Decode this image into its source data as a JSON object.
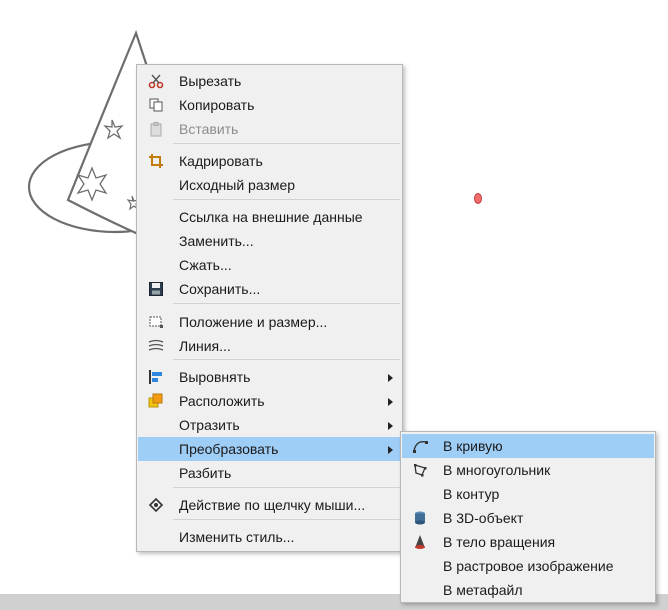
{
  "context_menu": {
    "items": [
      {
        "id": "cut",
        "label": "Вырезать",
        "icon": "scissors-icon",
        "enabled": true
      },
      {
        "id": "copy",
        "label": "Копировать",
        "icon": "copy-icon",
        "enabled": true
      },
      {
        "id": "paste",
        "label": "Вставить",
        "icon": "paste-icon",
        "enabled": false
      },
      {
        "id": "crop",
        "label": "Кадрировать",
        "icon": "crop-icon",
        "enabled": true
      },
      {
        "id": "original-size",
        "label": "Исходный размер",
        "enabled": true
      },
      {
        "id": "external-link",
        "label": "Ссылка на внешние данные",
        "enabled": true
      },
      {
        "id": "replace",
        "label": "Заменить...",
        "enabled": true
      },
      {
        "id": "compress",
        "label": "Сжать...",
        "enabled": true
      },
      {
        "id": "save",
        "label": "Сохранить...",
        "icon": "floppy-disk-icon",
        "enabled": true
      },
      {
        "id": "position-size",
        "label": "Положение и размер...",
        "icon": "position-size-icon",
        "enabled": true
      },
      {
        "id": "line",
        "label": "Линия...",
        "icon": "line-style-icon",
        "enabled": true
      },
      {
        "id": "align",
        "label": "Выровнять",
        "icon": "align-icon",
        "submenu": true
      },
      {
        "id": "arrange",
        "label": "Расположить",
        "icon": "arrange-icon",
        "submenu": true
      },
      {
        "id": "flip",
        "label": "Отразить",
        "submenu": true
      },
      {
        "id": "convert",
        "label": "Преобразовать",
        "submenu": true,
        "highlighted": true
      },
      {
        "id": "break",
        "label": "Разбить",
        "enabled": true
      },
      {
        "id": "interaction",
        "label": "Действие по щелчку мыши...",
        "icon": "interaction-icon",
        "enabled": true
      },
      {
        "id": "edit-style",
        "label": "Изменить стиль...",
        "enabled": true
      }
    ]
  },
  "convert_submenu": {
    "items": [
      {
        "id": "to-curve",
        "label": "В кривую",
        "icon": "bezier-curve-icon",
        "highlighted": true
      },
      {
        "id": "to-polygon",
        "label": "В многоугольник",
        "icon": "polygon-icon"
      },
      {
        "id": "to-contour",
        "label": "В контур"
      },
      {
        "id": "to-3d",
        "label": "В 3D-объект",
        "icon": "3d-object-icon"
      },
      {
        "id": "to-lathe",
        "label": "В тело вращения",
        "icon": "rotation-body-icon"
      },
      {
        "id": "to-bitmap",
        "label": "В растровое изображение"
      },
      {
        "id": "to-metafile",
        "label": "В метафайл"
      }
    ]
  },
  "colors": {
    "highlight": "#9ecdf5",
    "menu_bg": "#f0f0f0",
    "disabled_text": "#8c8c8c"
  }
}
